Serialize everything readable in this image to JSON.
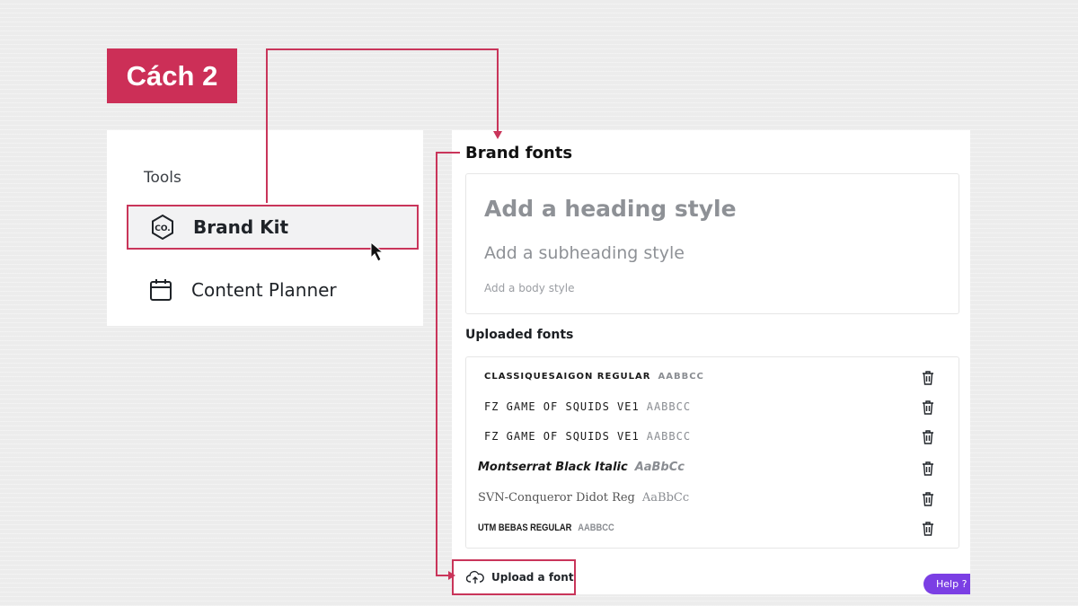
{
  "badge": {
    "label": "Cách 2"
  },
  "tools_panel": {
    "heading": "Tools",
    "items": [
      {
        "label": "Brand Kit",
        "icon": "brand-kit-co-icon"
      },
      {
        "label": "Content Planner",
        "icon": "calendar-icon"
      }
    ]
  },
  "brand_fonts": {
    "title": "Brand fonts",
    "heading_placeholder": "Add a heading style",
    "subheading_placeholder": "Add a subheading style",
    "body_placeholder": "Add a body style",
    "uploaded_title": "Uploaded fonts",
    "fonts": [
      {
        "name": "CLASSIQUESAIGON REGULAR",
        "sample": "AABBCC"
      },
      {
        "name": "FZ GAME OF SQUIDS VE1",
        "sample": "AABBCC"
      },
      {
        "name": "FZ GAME OF SQUIDS VE1",
        "sample": "AABBCC"
      },
      {
        "name": "Montserrat Black Italic",
        "sample": "AaBbCc"
      },
      {
        "name": "SVN-Conqueror Didot Reg",
        "sample": "AaBbCc"
      },
      {
        "name": "UTM BEBAS REGULAR",
        "sample": "AABBCC"
      }
    ],
    "upload_label": "Upload a font",
    "help_label": "Help ?"
  },
  "colors": {
    "accent": "#cc2f57",
    "help": "#7b3fe4",
    "placeholder": "#8e9196"
  }
}
